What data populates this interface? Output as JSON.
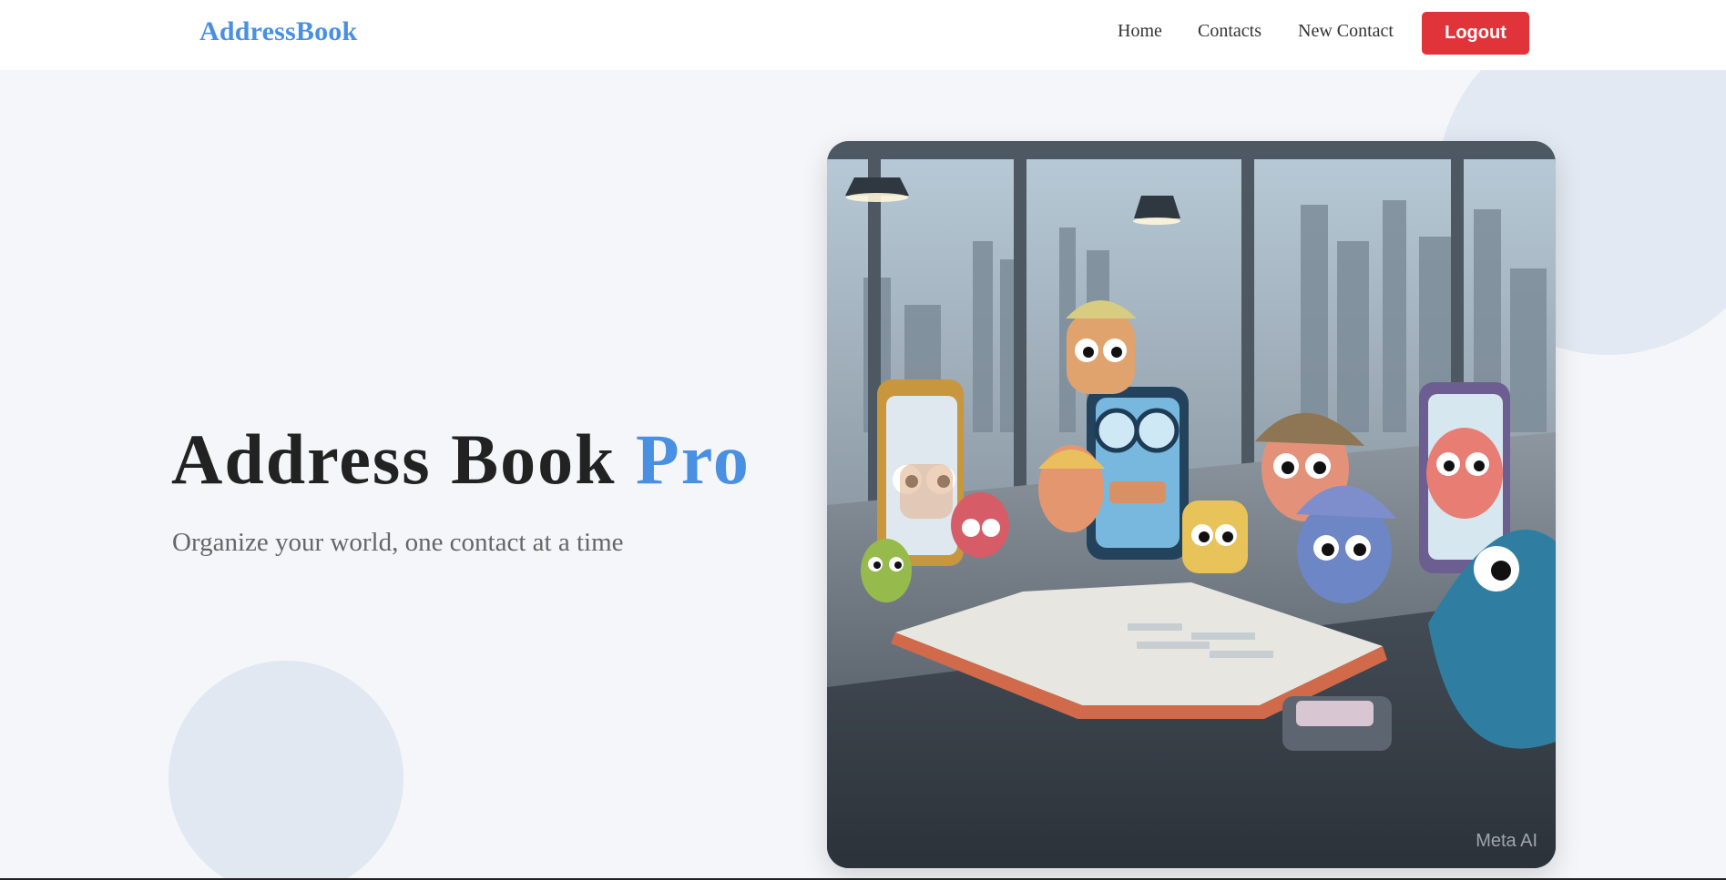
{
  "navbar": {
    "brand": "AddressBook",
    "links": [
      {
        "label": "Home"
      },
      {
        "label": "Contacts"
      },
      {
        "label": "New Contact"
      }
    ],
    "logout_label": "Logout"
  },
  "hero": {
    "title_main": "Address Book ",
    "title_accent": "Pro",
    "subtitle": "Organize your world, one contact at a time",
    "image_watermark": "Meta AI"
  },
  "colors": {
    "accent": "#4a90e2",
    "logout": "#e0343a",
    "background": "#f4f6f9",
    "title": "#222222",
    "subtitle": "#666666"
  }
}
